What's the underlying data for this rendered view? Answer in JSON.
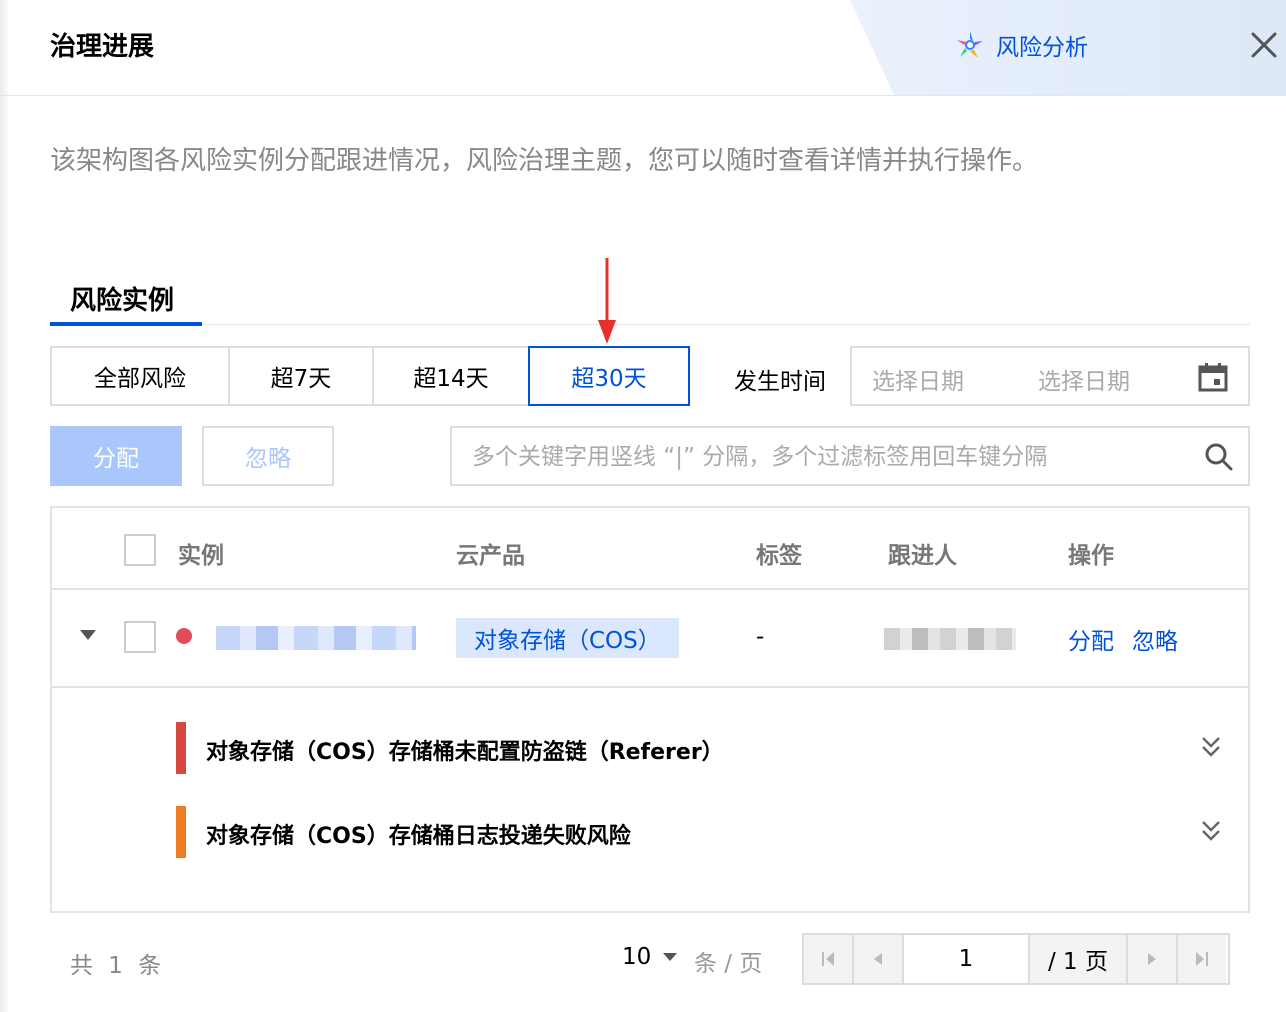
{
  "header": {
    "title": "治理进展",
    "risk_analysis_label": "风险分析"
  },
  "description": "该架构图各风险实例分配跟进情况，风险治理主题，您可以随时查看详情并执行操作。",
  "tabs": [
    {
      "label": "风险实例",
      "active": true
    }
  ],
  "filters": {
    "segments": [
      {
        "label": "全部风险",
        "active": false
      },
      {
        "label": "超7天",
        "active": false
      },
      {
        "label": "超14天",
        "active": false
      },
      {
        "label": "超30天",
        "active": true
      }
    ],
    "occur_time_label": "发生时间",
    "date_start_placeholder": "选择日期",
    "date_end_placeholder": "选择日期"
  },
  "actions": {
    "assign_label": "分配",
    "ignore_label": "忽略"
  },
  "search": {
    "placeholder": "多个关键字用竖线 “|” 分隔，多个过滤标签用回车键分隔"
  },
  "table": {
    "headers": {
      "instance": "实例",
      "product": "云产品",
      "tag": "标签",
      "owner": "跟进人",
      "operation": "操作"
    },
    "rows": [
      {
        "product": "对象存储（COS）",
        "tag": "-",
        "op_assign": "分配",
        "op_ignore": "忽略",
        "risks": [
          {
            "text": "对象存储（COS）存储桶未配置防盗链（Referer）",
            "color": "#d54941"
          },
          {
            "text": "对象存储（COS）存储桶日志投递失败风险",
            "color": "#f07c23"
          }
        ]
      }
    ]
  },
  "pagination": {
    "total_text": "共 1 条",
    "page_size": "10",
    "per_page_label": "条 / 页",
    "current_page": "1",
    "total_pages_text": "/ 1 页"
  },
  "colors": {
    "primary": "#0052d9",
    "primary_disabled": "#a9c7fa",
    "danger_dot": "#e34d59"
  }
}
